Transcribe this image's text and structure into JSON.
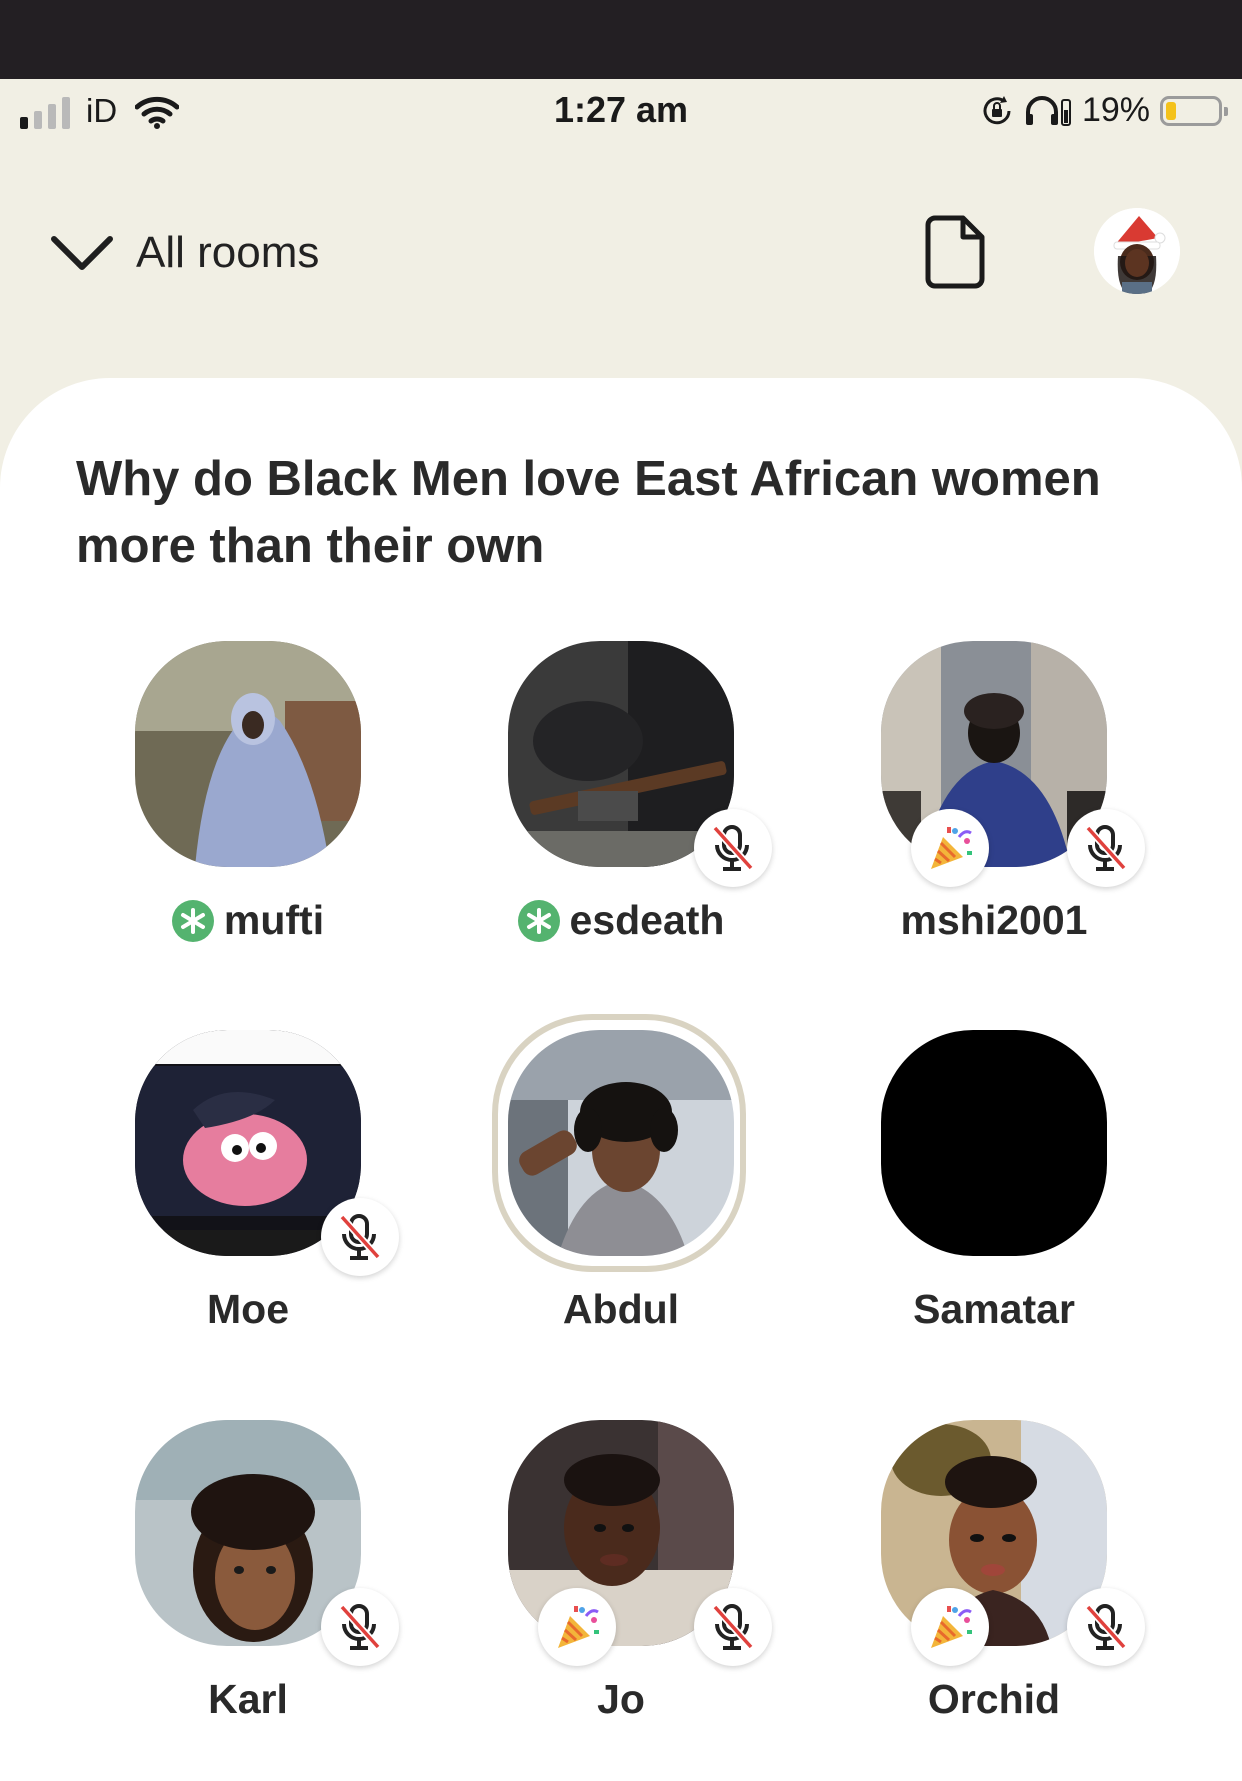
{
  "status_bar": {
    "carrier": "iD",
    "time": "1:27 am",
    "battery_percent": "19%",
    "battery_level": 0.19,
    "icons": [
      "signal-icon",
      "wifi-icon",
      "rotation-lock-icon",
      "headphones-icon",
      "battery-icon"
    ]
  },
  "header": {
    "back_label": "All rooms",
    "icons": [
      "chevron-down-icon",
      "document-icon",
      "profile-avatar"
    ]
  },
  "room": {
    "title": "Why do Black Men love East African women more than their own"
  },
  "participants": [
    {
      "name": "mufti",
      "moderator": true,
      "muted": false,
      "new_user": false
    },
    {
      "name": "esdeath",
      "moderator": true,
      "muted": true,
      "new_user": false
    },
    {
      "name": "mshi2001",
      "moderator": false,
      "muted": true,
      "new_user": true
    },
    {
      "name": "Moe",
      "moderator": false,
      "muted": true,
      "new_user": false
    },
    {
      "name": "Abdul",
      "moderator": false,
      "muted": false,
      "new_user": false,
      "speaking": true
    },
    {
      "name": "Samatar",
      "moderator": false,
      "muted": false,
      "new_user": false
    },
    {
      "name": "Karl",
      "moderator": false,
      "muted": true,
      "new_user": false
    },
    {
      "name": "Jo",
      "moderator": false,
      "muted": true,
      "new_user": true
    },
    {
      "name": "Orchid",
      "moderator": false,
      "muted": true,
      "new_user": true
    }
  ],
  "colors": {
    "background": "#f1efe4",
    "card": "#ffffff",
    "moderator_green": "#54b36f",
    "mute_red": "#e0413d",
    "speaking_ring": "#d9d3c2"
  }
}
